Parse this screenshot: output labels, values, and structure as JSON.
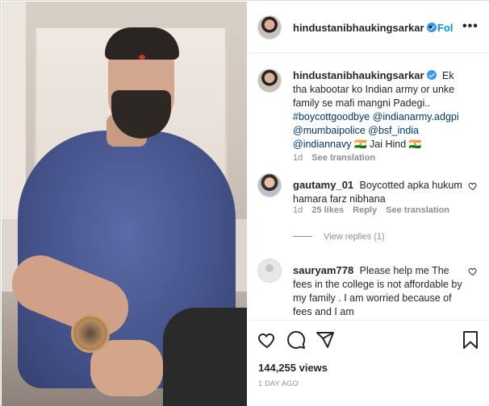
{
  "header": {
    "username": "hindustanibhaukingsarkar",
    "dot": "•",
    "follow_label": "Fol",
    "more_label": "•••"
  },
  "caption": {
    "username": "hindustanibhaukingsarkar",
    "text_pre": "Ek tha kabootar ko Indian army or unke family se mafi mangni Padegi..",
    "tags_line1": "#boycottgoodbye @indianarmy.adgpi",
    "tags_line2": "@mumbaipolice @bsf_india",
    "tags_line3": "@indiannavy",
    "text_post": "🇮🇳 Jai Hind 🇮🇳",
    "time": "1d",
    "see_translation": "See translation"
  },
  "comments": [
    {
      "username": "gautamy_01",
      "text": "Boycotted apka hukum hamara farz nibhana",
      "time": "1d",
      "likes": "25 likes",
      "reply": "Reply",
      "see_translation": "See translation"
    },
    {
      "username": "sauryam778",
      "text": "Please help me The fees in the college is not affordable by my family . I am worried because of fees and I am"
    }
  ],
  "view_replies": "View replies (1)",
  "stats": {
    "views": "144,255 views",
    "timestamp": "1 DAY AGO"
  },
  "icons": {
    "like": "heart-icon",
    "comment": "comment-bubble-icon",
    "share": "paper-plane-icon",
    "save": "bookmark-icon"
  },
  "colors": {
    "link": "#00376b",
    "follow": "#0095f6",
    "verified": "#3897f0",
    "muted": "#8e8e8e"
  }
}
